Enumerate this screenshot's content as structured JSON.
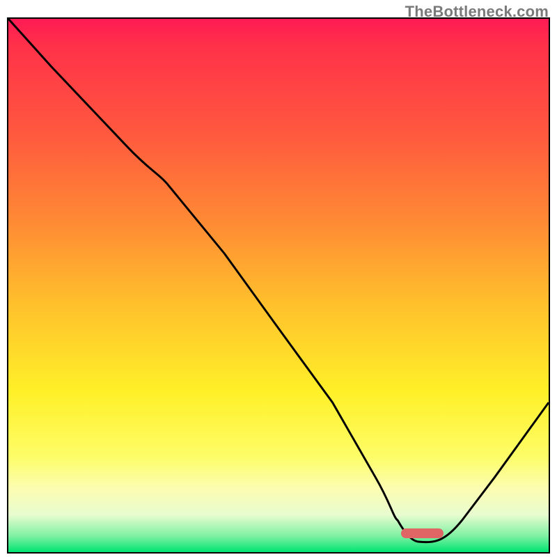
{
  "watermark": "TheBottleneck.com",
  "frame": {
    "border_color": "#000000",
    "border_width_px": 2
  },
  "gradient_stops": [
    {
      "pos": 0.0,
      "color": "#ff1a55"
    },
    {
      "pos": 0.05,
      "color": "#ff3149"
    },
    {
      "pos": 0.22,
      "color": "#ff5a3e"
    },
    {
      "pos": 0.38,
      "color": "#ff8a34"
    },
    {
      "pos": 0.54,
      "color": "#ffc22c"
    },
    {
      "pos": 0.7,
      "color": "#fff028"
    },
    {
      "pos": 0.82,
      "color": "#fdfd67"
    },
    {
      "pos": 0.88,
      "color": "#fcfdb0"
    },
    {
      "pos": 0.93,
      "color": "#e8fcd0"
    },
    {
      "pos": 0.97,
      "color": "#7ef0a1"
    },
    {
      "pos": 1.0,
      "color": "#00e472"
    }
  ],
  "marker": {
    "color": "#e06666",
    "x_frac": 0.727,
    "y_frac": 0.958,
    "width_frac": 0.078,
    "height_frac": 0.018,
    "radius_px": 8
  },
  "chart_data": {
    "type": "line",
    "title": "",
    "xlabel": "",
    "ylabel": "",
    "xlim": [
      0,
      100
    ],
    "ylim": [
      0,
      100
    ],
    "y_axis_note": "y increases downward in rendering; interpreted here as 100 at top, 0 at bottom (distance from optimum)",
    "series": [
      {
        "name": "bottleneck-curve",
        "x": [
          0,
          8,
          22,
          30,
          40,
          50,
          60,
          68,
          72,
          76,
          80,
          84,
          90,
          100
        ],
        "y": [
          100,
          91,
          76,
          70,
          56,
          42,
          28,
          14,
          6,
          2,
          2,
          6,
          14,
          28
        ],
        "stroke": "#000000",
        "stroke_width_px": 3
      }
    ],
    "highlight_range": {
      "x_start": 72,
      "x_end": 80,
      "y": 2
    }
  }
}
